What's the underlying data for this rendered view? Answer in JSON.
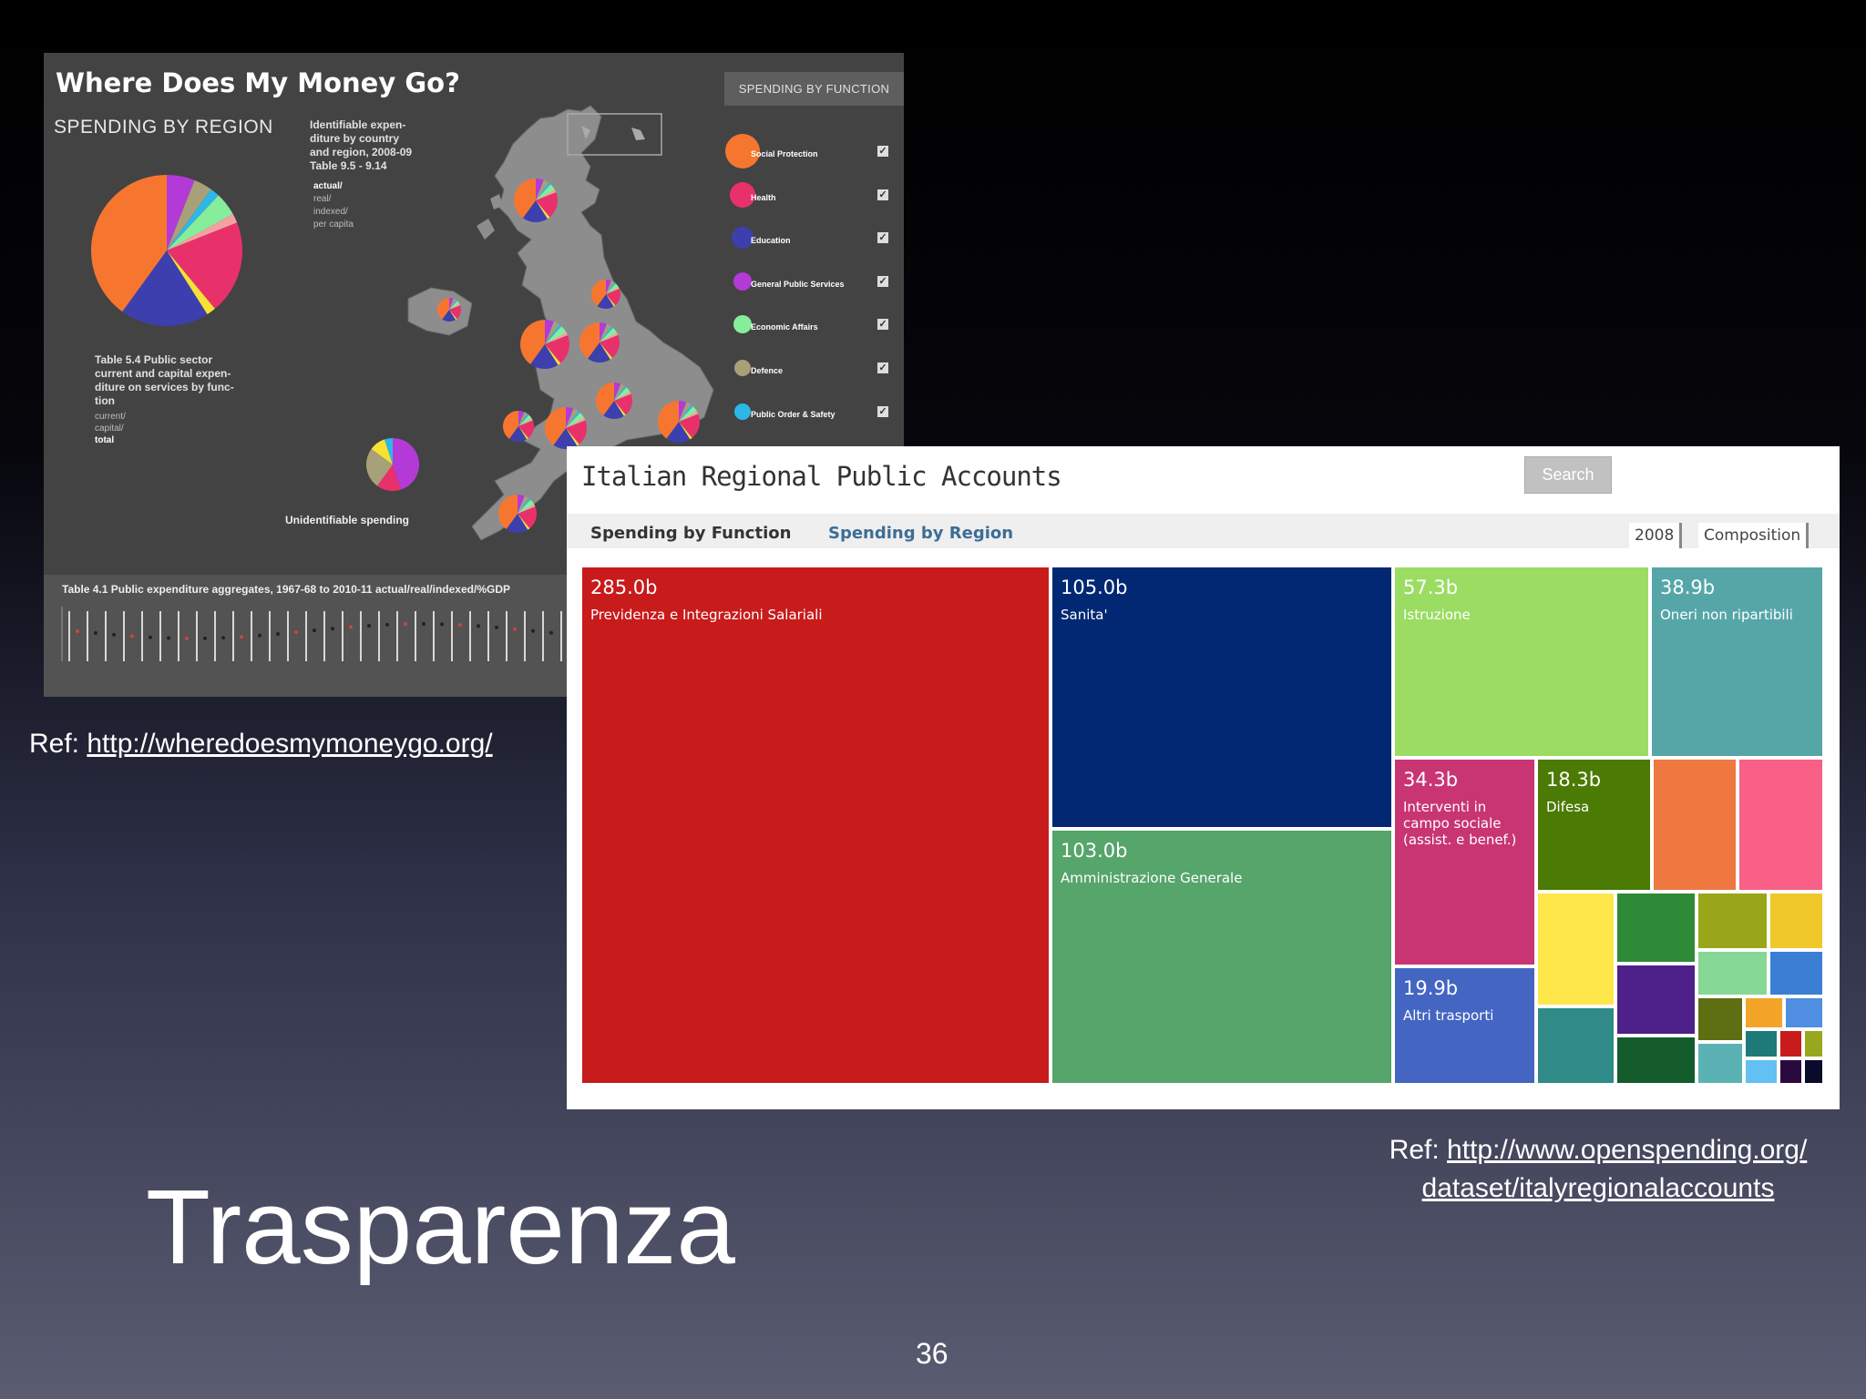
{
  "slide": {
    "title": "Trasparenza",
    "page_number": "36",
    "ref1": {
      "prefix": "Ref: ",
      "url": "http://wheredoesmymoneygo.org/"
    },
    "ref2": {
      "prefix": "Ref: ",
      "url_line1": "http://www.openspending.org/",
      "url_line2": "dataset/italyregionalaccounts"
    }
  },
  "wdmmg": {
    "title": "Where Does My Money Go?",
    "region_title": "SPENDING BY REGION",
    "table_note_lines": [
      "Identifiable expen-",
      "diture by country",
      "and region, 2008-09",
      "Table 9.5 - 9.14"
    ],
    "table_options": [
      "actual/",
      "real/",
      "indexed/",
      "per capita"
    ],
    "table2_note_lines": [
      "Table 5.4 Public sector",
      "current and capital expen-",
      "diture on services by func-",
      "tion"
    ],
    "table2_options": [
      "current/",
      "capital/",
      "total"
    ],
    "unidentifiable": "Unidentifiable spending",
    "function_tab": "SPENDING BY FUNCTION",
    "functions": [
      {
        "label": "Social Protection",
        "color": "#f7762f",
        "checked": true
      },
      {
        "label": "Health",
        "color": "#e8316b",
        "checked": true
      },
      {
        "label": "Education",
        "color": "#3d3fae",
        "checked": true
      },
      {
        "label": "General Public Services",
        "color": "#b43ad8",
        "checked": true
      },
      {
        "label": "Economic Affairs",
        "color": "#86ee9a",
        "checked": true
      },
      {
        "label": "Defence",
        "color": "#a8a078",
        "checked": true
      },
      {
        "label": "Public Order & Safety",
        "color": "#2db7e8",
        "checked": true
      }
    ],
    "timeline_title": "Table 4.1 Public expenditure aggregates, 1967-68 to 2010-11",
    "timeline_options": "actual/real/indexed/%GDP"
  },
  "italy": {
    "app_title": "Italian Regional Public Accounts",
    "search_label": "Search",
    "tabs": {
      "active": "Spending by Function",
      "link": "Spending by Region"
    },
    "year": "2008",
    "view": "Composition",
    "cells": [
      {
        "amount": "285.0b",
        "label": "Previdenza e Integrazioni Salariali",
        "color": "#c81b1b"
      },
      {
        "amount": "105.0b",
        "label": "Sanita'",
        "color": "#022874"
      },
      {
        "amount": "103.0b",
        "label": "Amministrazione Generale",
        "color": "#56a56b"
      },
      {
        "amount": "57.3b",
        "label": "Istruzione",
        "color": "#9bdc63"
      },
      {
        "amount": "38.9b",
        "label": "Oneri non ripartibili",
        "color": "#56a6a8"
      },
      {
        "amount": "34.3b",
        "label": "Interventi in campo sociale (assist. e benef.)",
        "color": "#c83572"
      },
      {
        "amount": "18.3b",
        "label": "Difesa",
        "color": "#4b7a05"
      },
      {
        "amount": "19.9b",
        "label": "Altri trasporti",
        "color": "#4465c2"
      }
    ]
  }
}
